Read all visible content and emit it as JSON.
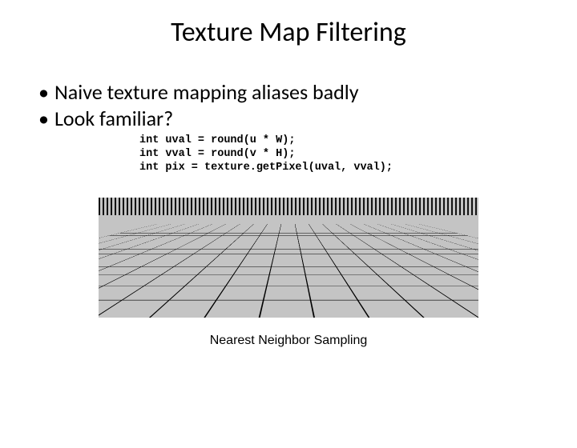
{
  "title": "Texture Map Filtering",
  "bullets": [
    "Naive texture mapping aliases badly",
    "Look familiar?"
  ],
  "code": {
    "line1": "int uval = round(u * W);",
    "line2": "int vval = round(v * H);",
    "line3": "int pix = texture.getPixel(uval, vval);"
  },
  "caption": "Nearest Neighbor Sampling"
}
